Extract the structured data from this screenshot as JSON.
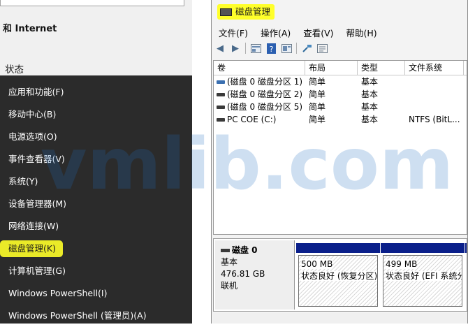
{
  "settings": {
    "network_title": "和 Internet",
    "status_title": "状态"
  },
  "winx_menu": {
    "items": [
      "应用和功能(F)",
      "移动中心(B)",
      "电源选项(O)",
      "事件查看器(V)",
      "系统(Y)",
      "设备管理器(M)",
      "网络连接(W)",
      "磁盘管理(K)",
      "计算机管理(G)",
      "Windows PowerShell(I)",
      "Windows PowerShell (管理员)(A)"
    ],
    "highlighted": "磁盘管理(K)"
  },
  "disk_mgmt": {
    "title": "磁盘管理",
    "menu": [
      "文件(F)",
      "操作(A)",
      "查看(V)",
      "帮助(H)"
    ],
    "toolbar_icons": [
      "back-arrow-icon",
      "forward-arrow-icon",
      "disk-view-icon",
      "help-icon",
      "properties-icon",
      "connect-icon",
      "settings-icon"
    ],
    "volume_columns": [
      "卷",
      "布局",
      "类型",
      "文件系统"
    ],
    "volumes": [
      {
        "name": "(磁盘 0 磁盘分区 1)",
        "layout": "简单",
        "type": "基本",
        "fs": "",
        "icon": "blue"
      },
      {
        "name": "(磁盘 0 磁盘分区 2)",
        "layout": "简单",
        "type": "基本",
        "fs": "",
        "icon": "dark"
      },
      {
        "name": "(磁盘 0 磁盘分区 5)",
        "layout": "简单",
        "type": "基本",
        "fs": "",
        "icon": "dark"
      },
      {
        "name": "PC COE (C:)",
        "layout": "简单",
        "type": "基本",
        "fs": "NTFS (BitL...",
        "icon": "dark"
      }
    ],
    "disk": {
      "name": "磁盘 0",
      "type": "基本",
      "size": "476.81 GB",
      "state": "联机"
    },
    "partitions": [
      {
        "size": "500 MB",
        "status": "状态良好 (恢复分区)"
      },
      {
        "size": "499 MB",
        "status": "状态良好 (EFI 系统分"
      }
    ]
  },
  "watermark": "vmlib.com",
  "colors": {
    "menu_bg": "#2b2b2b",
    "highlight": "#ffff2a",
    "partition_bar": "#0a1f8a"
  }
}
